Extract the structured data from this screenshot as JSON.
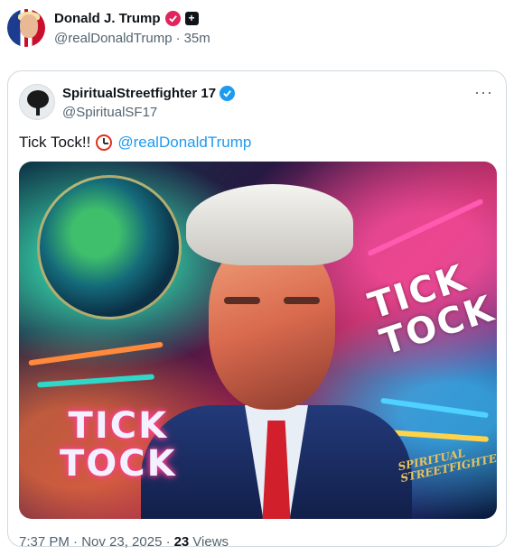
{
  "outer_post": {
    "display_name": "Donald J. Trump",
    "handle": "@realDonaldTrump",
    "separator": "·",
    "time_ago": "35m"
  },
  "quoted_post": {
    "display_name": "SpiritualStreetfighter 17",
    "handle": "@SpiritualSF17",
    "more_label": "···",
    "text": "Tick Tock!!",
    "mention": "@realDonaldTrump",
    "image": {
      "left_text_line1": "TICK",
      "left_text_line2": "TOCK",
      "right_text_line1": "TICK",
      "right_text_line2": "TOCK",
      "logo_line1": "SPIRITUAL",
      "logo_line2": "STREETFIGHTER"
    },
    "timestamp": "7:37 PM · Nov 23, 2025 ·",
    "views_count": "23",
    "views_label": "Views"
  },
  "colors": {
    "accent_blue": "#1d9bf0",
    "badge_pink": "#e0245e",
    "secondary_text": "#536471"
  },
  "icons": [
    "verified-badge-icon",
    "affiliate-badge-icon",
    "alarm-clock-emoji-icon",
    "more-icon"
  ]
}
